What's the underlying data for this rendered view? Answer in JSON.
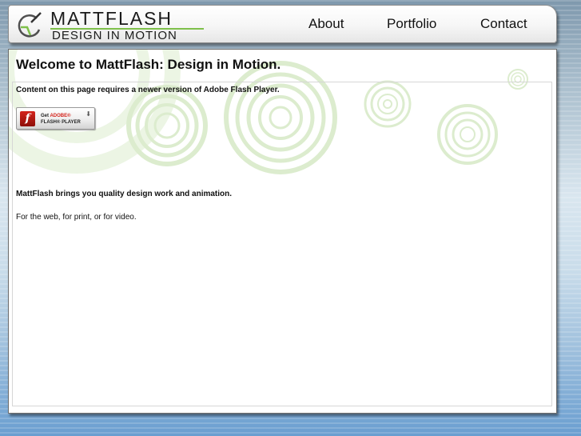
{
  "header": {
    "logo": {
      "title": "MATTFLASH",
      "subtitle": "DESIGN IN MOTION"
    },
    "nav": [
      {
        "label": "About"
      },
      {
        "label": "Portfolio"
      },
      {
        "label": "Contact"
      }
    ]
  },
  "main": {
    "title": "Welcome to MattFlash: Design in Motion.",
    "flash_notice": "Content on this page requires a newer version of Adobe Flash Player.",
    "flash_badge": {
      "get": "Get ",
      "adobe": "ADOBE®",
      "player": "FLASH® PLAYER"
    },
    "tagline": "MattFlash brings you quality design work and animation.",
    "subline": "For the web, for print, or for video."
  },
  "colors": {
    "accent_green": "#7ec04a",
    "decor_green": "#d9ebc9",
    "flash_red": "#d4231b"
  },
  "icons": [
    "logo-swirl-icon",
    "flash-icon",
    "download-arrow-icon"
  ]
}
